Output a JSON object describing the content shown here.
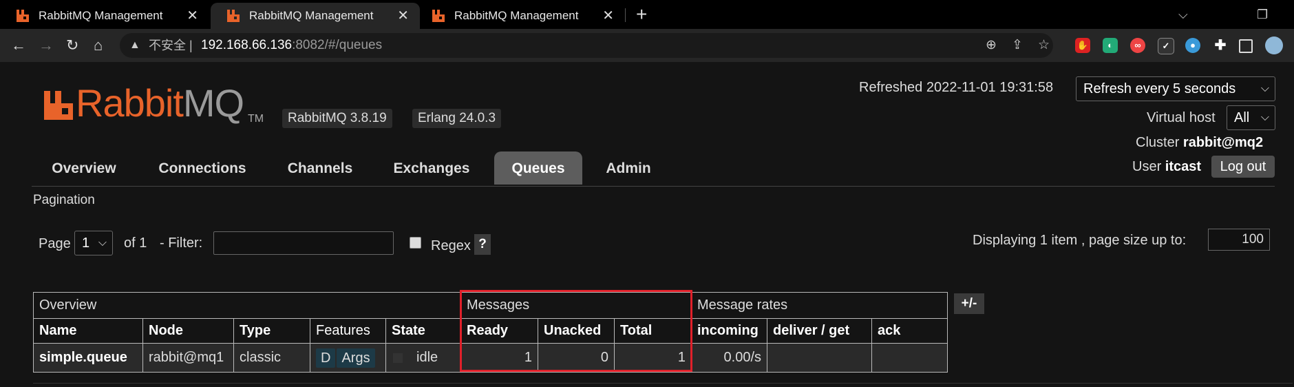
{
  "browser": {
    "tabs": [
      {
        "title": "RabbitMQ Management",
        "active": false
      },
      {
        "title": "RabbitMQ Management",
        "active": true
      },
      {
        "title": "RabbitMQ Management",
        "active": false
      }
    ],
    "new_tab_glyph": "+",
    "close_glyph": "✕",
    "address": {
      "security_label": "不安全",
      "separator": "|",
      "host": "192.168.66.136",
      "path": ":8082/#/queues"
    },
    "extensions": [
      "adblock-icon",
      "color-icon",
      "infinity-icon",
      "check-icon",
      "bird-icon",
      "puzzle-icon",
      "sidebar-icon",
      "profile-avatar"
    ]
  },
  "header": {
    "logo_rabbit": "Rabbit",
    "logo_mq": "MQ",
    "logo_tm": "TM",
    "rabbitmq_version": "RabbitMQ 3.8.19",
    "erlang_version": "Erlang 24.0.3",
    "refreshed_label": "Refreshed 2022-11-01 19:31:58",
    "refresh_select": "Refresh every 5 seconds",
    "virtual_host_label": "Virtual host",
    "virtual_host_value": "All",
    "cluster_label": "Cluster",
    "cluster_value": "rabbit@mq2",
    "user_label": "User",
    "user_value": "itcast",
    "logout_label": "Log out"
  },
  "nav": {
    "tabs": [
      "Overview",
      "Connections",
      "Channels",
      "Exchanges",
      "Queues",
      "Admin"
    ],
    "active": "Queues"
  },
  "pagination": {
    "section_label": "Pagination",
    "page_label": "Page",
    "page_value": "1",
    "of_label": "of 1",
    "filter_label": "- Filter:",
    "filter_value": "",
    "regex_label": "Regex",
    "regex_checked": false,
    "help_label": "?",
    "displaying_label": "Displaying 1 item , page size up to:",
    "page_size": "100"
  },
  "table": {
    "groups": [
      "Overview",
      "Messages",
      "Message rates"
    ],
    "columns_toggle": "+/-",
    "headers": [
      "Name",
      "Node",
      "Type",
      "Features",
      "State",
      "Ready",
      "Unacked",
      "Total",
      "incoming",
      "deliver / get",
      "ack"
    ],
    "rows": [
      {
        "name": "simple.queue",
        "node": "rabbit@mq1",
        "type": "classic",
        "features": [
          "D",
          "Args"
        ],
        "state": "idle",
        "ready": "1",
        "unacked": "0",
        "total": "1",
        "incoming": "0.00/s",
        "deliver_get": "",
        "ack": ""
      }
    ]
  },
  "colors": {
    "accent_orange": "#e8632a",
    "highlight_box": "#e0202a",
    "background": "#141414"
  }
}
